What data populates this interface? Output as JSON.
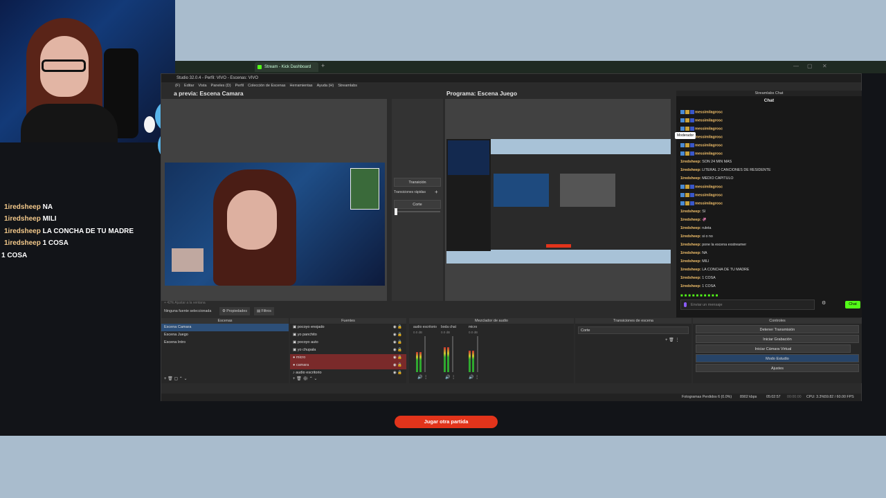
{
  "browser": {
    "tab_title": "Stream - Kick Dashboard",
    "new_tab": "+"
  },
  "overlay_chat": [
    {
      "user": "1iredsheep",
      "message": "NA"
    },
    {
      "user": "1iredsheep",
      "message": "MILI"
    },
    {
      "user": "1iredsheep",
      "message": "LA CONCHA DE TU MADRE"
    },
    {
      "user": "1iredsheep",
      "message": "1 COSA"
    },
    {
      "user": "",
      "message": "1 COSA"
    }
  ],
  "obs": {
    "title": "Studio 32.0.4 - Perfil: VIVO - Escenas: VIVO",
    "menu": [
      "Editar",
      "Vista",
      "Paneles (D)",
      "Perfil",
      "Colección de Escenas",
      "Herramientas",
      "Ayuda (H)",
      "Streamlabs"
    ],
    "menu_first": "(F)",
    "preview_label": "a previa: Escena Camara",
    "program_label": "Programa: Escena Juego",
    "transition_button": "Transición",
    "quick_transitions": "Transiciones rápidas",
    "transition_select": "Corte",
    "no_source": "Ninguna fuente seleccionada",
    "properties": "Propiedades",
    "filters": "Filtros",
    "zoom_bar": "+  42%       Ajustar a la ventana"
  },
  "chat_panel": {
    "header": "Streamlabs Chat",
    "title": "Chat",
    "tooltip": "Moderador",
    "lines": [
      {
        "user": "messimilagrosc",
        "msg": "",
        "badges": 3
      },
      {
        "user": "messimilagrosc",
        "msg": "",
        "badges": 3
      },
      {
        "user": "messimilagrosc",
        "msg": "",
        "badges": 3
      },
      {
        "user": "messimilagrosc",
        "msg": "",
        "badges": 3
      },
      {
        "user": "messimilagrosc",
        "msg": "",
        "badges": 3
      },
      {
        "user": "messimilagrosc",
        "msg": "",
        "badges": 3
      },
      {
        "user": "1iredsheep:",
        "msg": "SON 24 MIN MAS",
        "badges": 0
      },
      {
        "user": "1iredsheep:",
        "msg": "LITERAL 2 CANCIONES DE RESIDENTE",
        "badges": 0
      },
      {
        "user": "1iredsheep:",
        "msg": "MEDIO CAPITULO",
        "badges": 0
      },
      {
        "user": "messimilagrosc",
        "msg": "",
        "badges": 3
      },
      {
        "user": "messimilagrosc",
        "msg": "",
        "badges": 3
      },
      {
        "user": "messimilagrosc",
        "msg": "",
        "badges": 3
      },
      {
        "user": "1iredsheep:",
        "msg": "SI",
        "badges": 0
      },
      {
        "user": "1iredsheep:",
        "msg": "🦑",
        "badges": 0
      },
      {
        "user": "1iredsheep:",
        "msg": "ruleta",
        "badges": 0
      },
      {
        "user": "1iredsheep:",
        "msg": "si o no",
        "badges": 0
      },
      {
        "user": "1iredsheep:",
        "msg": "pone la escena exstreamer",
        "badges": 0
      },
      {
        "user": "1iredsheep:",
        "msg": "NA",
        "badges": 0
      },
      {
        "user": "1iredsheep:",
        "msg": "MILI",
        "badges": 0
      },
      {
        "user": "1iredsheep:",
        "msg": "LA CONCHA DE TU MADRE",
        "badges": 0
      },
      {
        "user": "1iredsheep:",
        "msg": "1 COSA",
        "badges": 0
      },
      {
        "user": "1iredsheep:",
        "msg": "1 COSA",
        "badges": 0
      }
    ],
    "input_placeholder": "Enviar un mensaje",
    "send": "Chat"
  },
  "docks": {
    "scenes": {
      "title": "Escenas",
      "items": [
        "Escena Camara",
        "Escena Juego",
        "Escena Intro"
      ]
    },
    "sources": {
      "title": "Fuentes",
      "items": [
        "pocoyo enojado",
        "yo panchito",
        "pocoyo auto",
        "yo chupala",
        "micro",
        "camara",
        "audio escritorio"
      ]
    },
    "mixer": {
      "title": "Mezclador de audio",
      "channels": [
        {
          "name": "audio escritorio",
          "db": "0.0 dB",
          "level": 0.55
        },
        {
          "name": "boda chat",
          "db": "0.0 dB",
          "level": 0.7
        },
        {
          "name": "micro",
          "db": "0.0 dB",
          "level": 0.6
        }
      ]
    },
    "transitions": {
      "title": "Transiciones de escena",
      "value": "Corte"
    },
    "controls": {
      "title": "Controles",
      "buttons": [
        "Detener Transmisión",
        "Iniciar Grabación",
        "Iniciar Cámara Virtual",
        "Modo Estudio",
        "Ajustes"
      ]
    }
  },
  "status": {
    "dropped": "Fotogramas Perdidos 6 (0.0%)",
    "bitrate": "8902 kbps",
    "stream_time": "05:02:57",
    "rec_time": "00:00:00",
    "cpu": "CPU: 3.3%",
    "fps": "59.82 / 60.00 FPS"
  },
  "game": {
    "play_again": "Jugar otra partida"
  }
}
